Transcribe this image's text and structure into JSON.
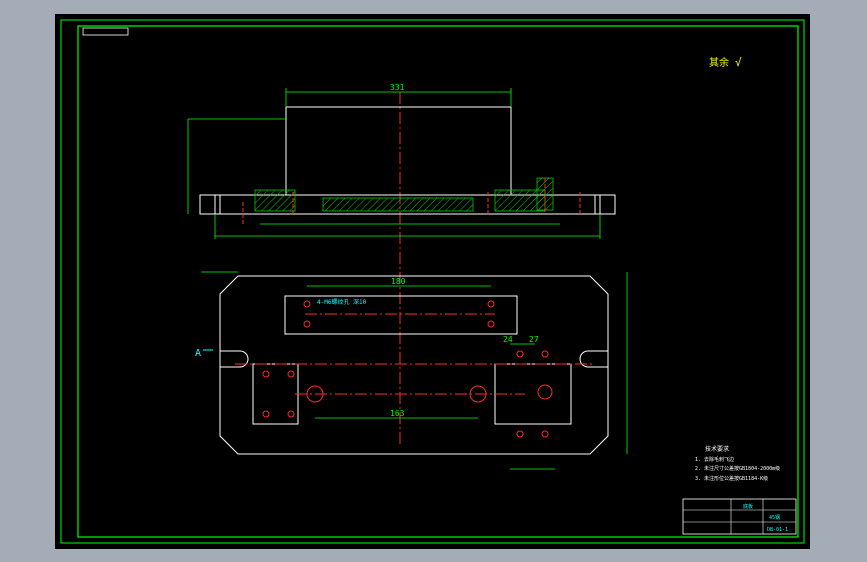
{
  "drawing": {
    "background": "#000000",
    "frame_color": "#00ff00",
    "outline_color": "#ffffff",
    "center_line_color": "#ff2a2a",
    "hatch_color": "#00cc00",
    "dim_color": "#00ff00",
    "note_color": "#00ffff",
    "symbol_color": "#ffff00"
  },
  "roughness": {
    "mark": "其余",
    "symbol": "√"
  },
  "dimensions": {
    "top_width": "331",
    "hole_spacing_upper": "180",
    "hole_spacing_lower": "163",
    "left_boss_width": "24",
    "right_boss_width": "27"
  },
  "section_label": "A",
  "callout_note": "4-M6螺纹孔\n深10",
  "tech_requirements": {
    "title": "技术要求",
    "items": [
      "1. 去除毛刺飞边",
      "2. 未注尺寸公差按GB1804-2000m级",
      "3. 未注形位公差按GB1184-K级"
    ]
  },
  "title_block": {
    "part_name": "底板",
    "material": "45钢",
    "drawing_no": "DB-01-1"
  }
}
